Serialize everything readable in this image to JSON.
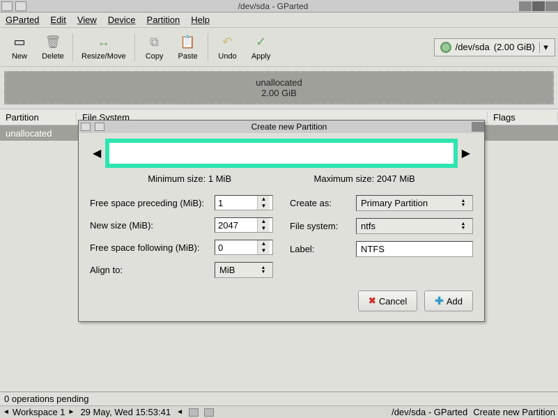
{
  "window": {
    "title": "/dev/sda - GParted"
  },
  "menu": {
    "gparted": "GParted",
    "edit": "Edit",
    "view": "View",
    "device": "Device",
    "partition": "Partition",
    "help": "Help"
  },
  "toolbar": {
    "new": "New",
    "delete": "Delete",
    "resize": "Resize/Move",
    "copy": "Copy",
    "paste": "Paste",
    "undo": "Undo",
    "apply": "Apply",
    "device": "/dev/sda",
    "device_size": "(2.00 GiB)"
  },
  "diskmap": {
    "name": "unallocated",
    "size": "2.00 GiB"
  },
  "table": {
    "cols": {
      "partition": "Partition",
      "fs": "File System",
      "flags": "Flags"
    },
    "row0": {
      "partition": "unallocated"
    }
  },
  "status": {
    "text": "0 operations pending"
  },
  "taskbar": {
    "workspace": "Workspace 1",
    "clock": "29 May, Wed 15:53:41",
    "task1": "/dev/sda - GParted",
    "task2": "Create new Partition"
  },
  "dialog": {
    "title": "Create new Partition",
    "min_size": "Minimum size: 1 MiB",
    "max_size": "Maximum size: 2047 MiB",
    "free_preceding_label": "Free space preceding (MiB):",
    "free_preceding_value": "1",
    "new_size_label": "New size (MiB):",
    "new_size_value": "2047",
    "free_following_label": "Free space following (MiB):",
    "free_following_value": "0",
    "align_label": "Align to:",
    "align_value": "MiB",
    "create_as_label": "Create as:",
    "create_as_value": "Primary Partition",
    "filesystem_label": "File system:",
    "filesystem_value": "ntfs",
    "label_label": "Label:",
    "label_value": "NTFS",
    "cancel": "Cancel",
    "add": "Add"
  }
}
